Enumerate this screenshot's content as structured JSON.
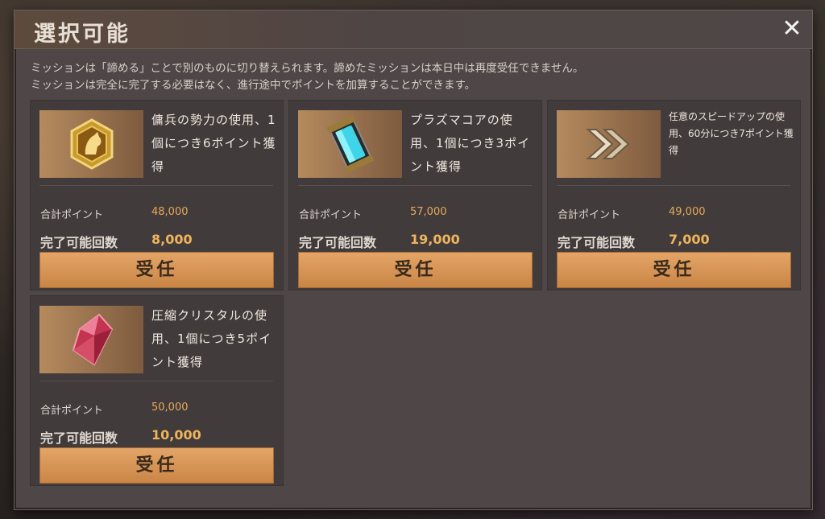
{
  "dialog": {
    "title": "選択可能",
    "close_label": "✕",
    "notice_line1": "ミッションは「諦める」ことで別のものに切り替えられます。諦めたミッションは本日中は再度受任できません。",
    "notice_line2": "ミッションは完全に完了する必要はなく、進行途中でポイントを加算することができます。"
  },
  "missions": [
    {
      "icon": "mercenary-emblem-icon",
      "description": "傭兵の勢力の使用、1個につき6ポイント獲得",
      "total_label": "合計ポイント",
      "total_value": "48,000",
      "count_label": "完了可能回数",
      "count_value": "8,000",
      "button_label": "受任"
    },
    {
      "icon": "plasma-core-icon",
      "description": "プラズマコアの使用、1個につき3ポイント獲得",
      "total_label": "合計ポイント",
      "total_value": "57,000",
      "count_label": "完了可能回数",
      "count_value": "19,000",
      "button_label": "受任"
    },
    {
      "icon": "speedup-chevrons-icon",
      "description": "任意のスピードアップの使用、60分につき7ポイント獲得",
      "total_label": "合計ポイント",
      "total_value": "49,000",
      "count_label": "完了可能回数",
      "count_value": "7,000",
      "button_label": "受任"
    },
    {
      "icon": "compressed-crystal-icon",
      "description": "圧縮クリスタルの使用、1個につき5ポイント獲得",
      "total_label": "合計ポイント",
      "total_value": "50,000",
      "count_label": "完了可能回数",
      "count_value": "10,000",
      "button_label": "受任"
    }
  ],
  "colors": {
    "panel": "#4f4747",
    "card": "#423b3b",
    "accent_value": "#f0b45c",
    "button": "#d9954f"
  }
}
